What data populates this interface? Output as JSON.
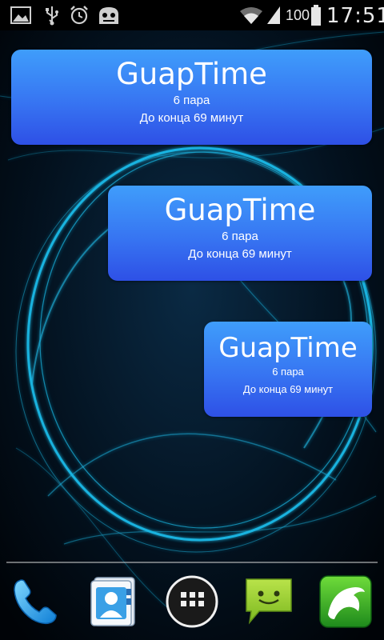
{
  "status_bar": {
    "battery_level": "100",
    "time": "17:51",
    "icons": [
      "gallery-icon",
      "usb-icon",
      "alarm-icon",
      "cyanogenmod-icon",
      "wifi-icon",
      "signal-icon",
      "battery-icon"
    ]
  },
  "widgets": [
    {
      "title": "GuapTime",
      "pair": "6 пара",
      "remaining": "До конца 69 минут"
    },
    {
      "title": "GuapTime",
      "pair": "6 пара",
      "remaining": "До конца 69 минут"
    },
    {
      "title": "GuapTime",
      "pair": "6 пара",
      "remaining": "До конца 69 минут"
    }
  ],
  "dock": {
    "apps": [
      "phone-icon",
      "contacts-icon",
      "app-drawer-icon",
      "messaging-icon",
      "dolphin-browser-icon"
    ]
  },
  "colors": {
    "widget_top": "#3f9dfb",
    "widget_bottom": "#2e50e6",
    "wallpaper_glow": "#1fc6f5"
  }
}
